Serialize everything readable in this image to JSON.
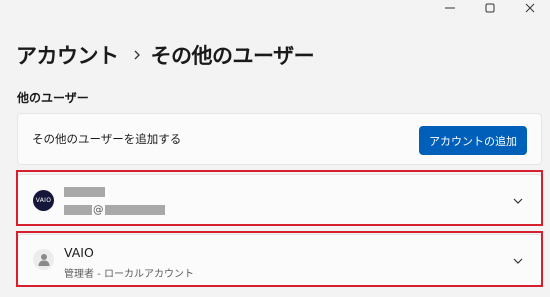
{
  "window": {
    "controls": [
      "minimize-icon",
      "maximize-icon",
      "close-icon"
    ]
  },
  "breadcrumb": {
    "root": "アカウント",
    "separator_icon": "chevron-right-icon",
    "current": "その他のユーザー"
  },
  "other_users": {
    "section_title": "他のユーザー",
    "add_user_label": "その他のユーザーを追加する",
    "add_account_button": "アカウントの追加"
  },
  "users": [
    {
      "avatar_icon": "vaio-logo-avatar",
      "avatar_text": "VAIO",
      "name_redacted": true,
      "email_at": "@",
      "expand_icon": "chevron-down-icon"
    },
    {
      "avatar_icon": "person-icon",
      "name": "VAIO",
      "role": "管理者 - ローカルアカウント",
      "expand_icon": "chevron-down-icon"
    }
  ],
  "colors": {
    "accent": "#005fb8",
    "highlight": "#d7202f",
    "background": "#f3f3f3"
  }
}
